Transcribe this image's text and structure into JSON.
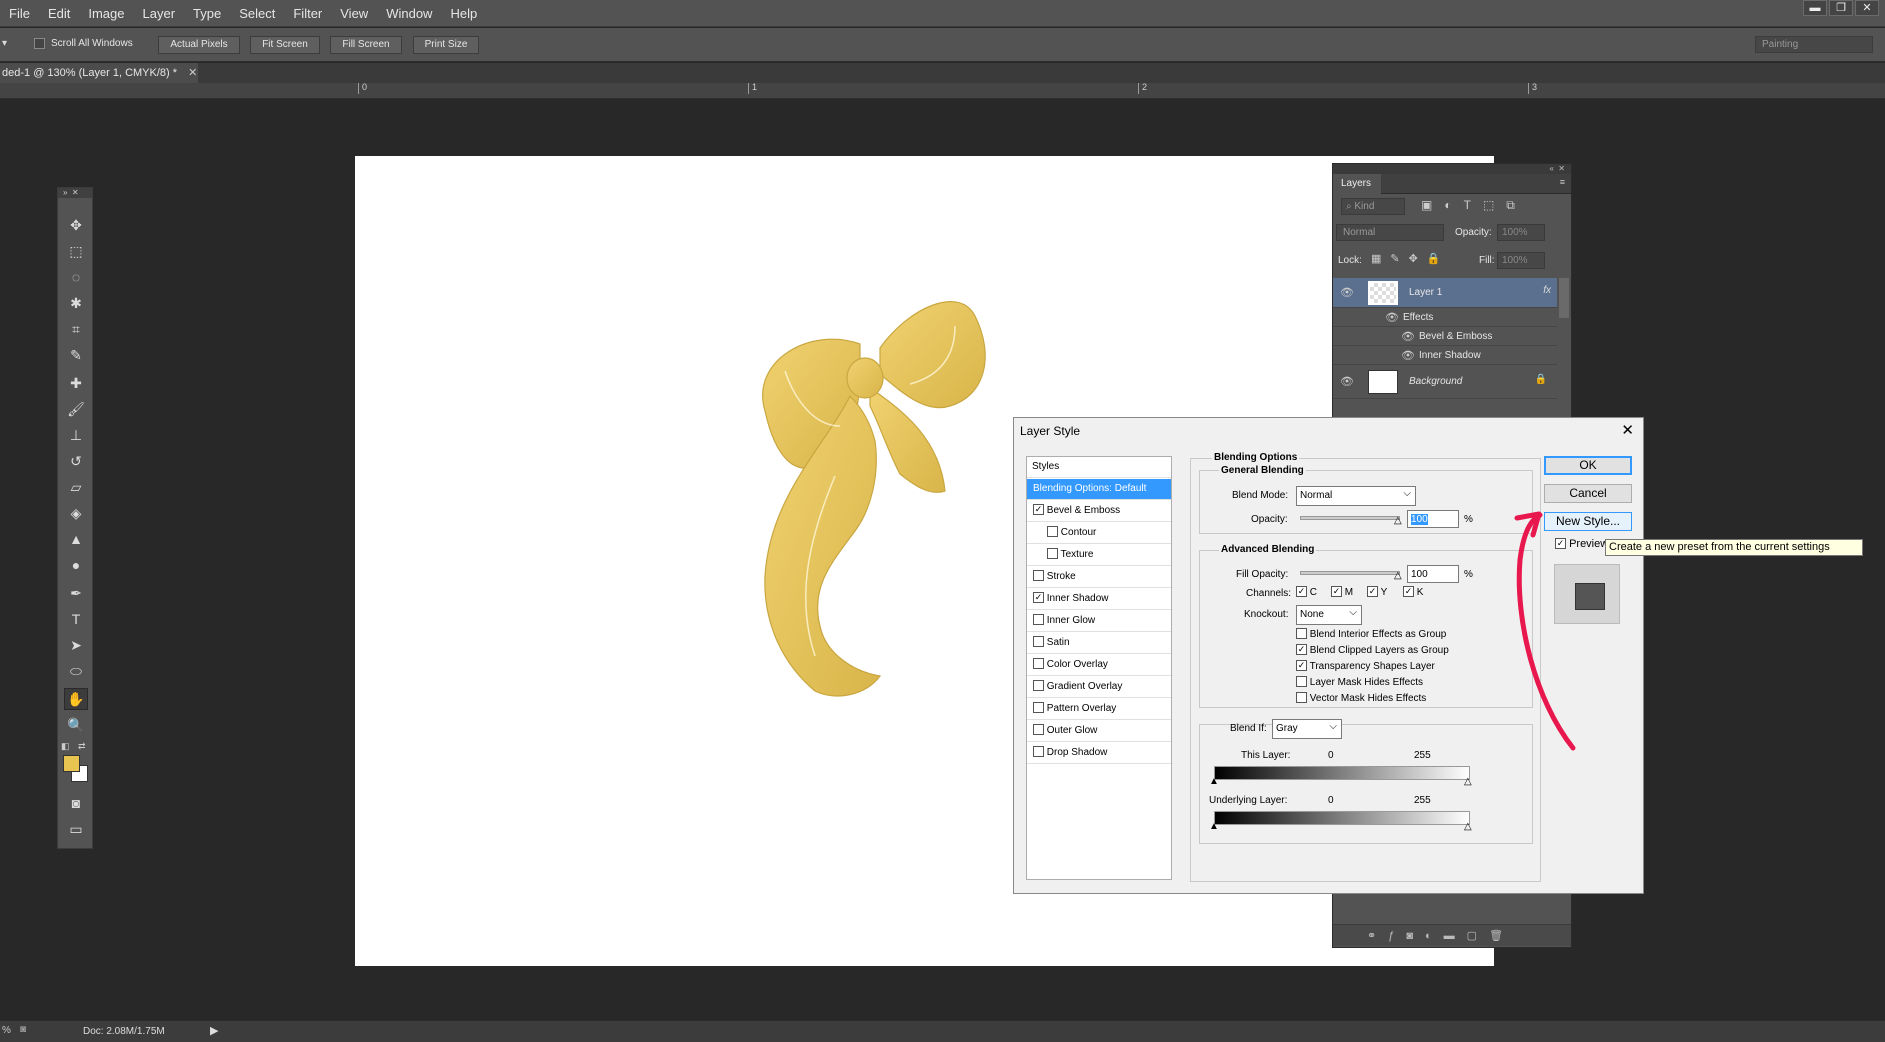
{
  "menubar": {
    "items": [
      "File",
      "Edit",
      "Image",
      "Layer",
      "Type",
      "Select",
      "Filter",
      "View",
      "Window",
      "Help"
    ],
    "window_controls": [
      "▬",
      "❐",
      "✕"
    ]
  },
  "options_bar": {
    "scroll_all_windows": "Scroll All Windows",
    "buttons": [
      "Actual Pixels",
      "Fit Screen",
      "Fill Screen",
      "Print Size"
    ],
    "workspace": "Painting"
  },
  "document": {
    "tab_title": "ded-1 @ 130% (Layer 1, CMYK/8) *",
    "ruler_marks": [
      "0",
      "1",
      "2",
      "3"
    ]
  },
  "layers_panel": {
    "title": "Layers",
    "kind": "Kind",
    "blend_mode": "Normal",
    "opacity_label": "Opacity:",
    "opacity_value": "100%",
    "lock_label": "Lock:",
    "fill_label": "Fill:",
    "fill_value": "100%",
    "layers": [
      {
        "name": "Layer 1",
        "fx": "fx"
      },
      {
        "name": "Background"
      }
    ],
    "effects_label": "Effects",
    "effects": [
      "Bevel & Emboss",
      "Inner Shadow"
    ]
  },
  "dialog": {
    "title": "Layer Style",
    "close": "✕",
    "styles_header": "Styles",
    "styles": [
      {
        "label": "Blending Options: Default",
        "checked": null,
        "selected": true,
        "indent": false
      },
      {
        "label": "Bevel & Emboss",
        "checked": true,
        "selected": false,
        "indent": false
      },
      {
        "label": "Contour",
        "checked": false,
        "selected": false,
        "indent": true
      },
      {
        "label": "Texture",
        "checked": false,
        "selected": false,
        "indent": true
      },
      {
        "label": "Stroke",
        "checked": false,
        "selected": false,
        "indent": false
      },
      {
        "label": "Inner Shadow",
        "checked": true,
        "selected": false,
        "indent": false
      },
      {
        "label": "Inner Glow",
        "checked": false,
        "selected": false,
        "indent": false
      },
      {
        "label": "Satin",
        "checked": false,
        "selected": false,
        "indent": false
      },
      {
        "label": "Color Overlay",
        "checked": false,
        "selected": false,
        "indent": false
      },
      {
        "label": "Gradient Overlay",
        "checked": false,
        "selected": false,
        "indent": false
      },
      {
        "label": "Pattern Overlay",
        "checked": false,
        "selected": false,
        "indent": false
      },
      {
        "label": "Outer Glow",
        "checked": false,
        "selected": false,
        "indent": false
      },
      {
        "label": "Drop Shadow",
        "checked": false,
        "selected": false,
        "indent": false
      }
    ],
    "blending_options": "Blending Options",
    "general_blending": "General Blending",
    "blend_mode_label": "Blend Mode:",
    "blend_mode_value": "Normal",
    "opacity_label": "Opacity:",
    "opacity_value": "100",
    "percent": "%",
    "advanced_blending": "Advanced Blending",
    "fill_opacity_label": "Fill Opacity:",
    "fill_opacity_value": "100",
    "channels_label": "Channels:",
    "channels": [
      "C",
      "M",
      "Y",
      "K"
    ],
    "knockout_label": "Knockout:",
    "knockout_value": "None",
    "options": [
      {
        "label": "Blend Interior Effects as Group",
        "checked": false
      },
      {
        "label": "Blend Clipped Layers as Group",
        "checked": true
      },
      {
        "label": "Transparency Shapes Layer",
        "checked": true
      },
      {
        "label": "Layer Mask Hides Effects",
        "checked": false
      },
      {
        "label": "Vector Mask Hides Effects",
        "checked": false
      }
    ],
    "blend_if_label": "Blend If:",
    "blend_if_value": "Gray",
    "this_layer_label": "This Layer:",
    "underlying_layer_label": "Underlying Layer:",
    "range_min": "0",
    "range_max": "255",
    "ok": "OK",
    "cancel": "Cancel",
    "new_style": "New Style...",
    "preview": "Preview",
    "tooltip": "Create a new preset from the current settings"
  },
  "statusbar": {
    "zoom": "%",
    "doc_info": "Doc: 2.08M/1.75M"
  },
  "colors": {
    "foreground": "#e8c550",
    "background": "#ffffff",
    "selection": "#3399ff",
    "arrow": "#e8174d"
  }
}
